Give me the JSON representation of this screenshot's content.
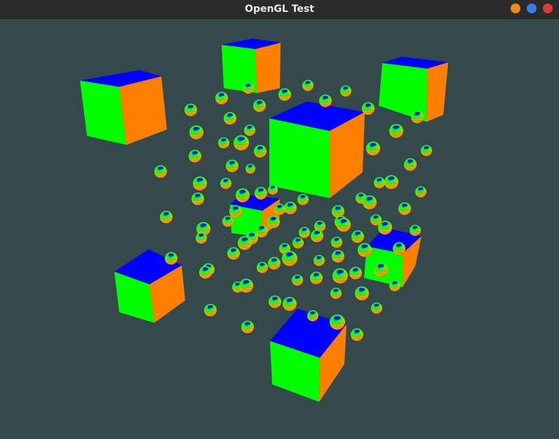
{
  "window": {
    "title": "OpenGL Test",
    "controls": [
      {
        "name": "minimize",
        "color": "#f08a1c"
      },
      {
        "name": "maximize",
        "color": "#3b7cea"
      },
      {
        "name": "close",
        "color": "#e03b3b"
      }
    ]
  },
  "scene": {
    "background": "#33494b",
    "status_text": "",
    "colors": {
      "cube_top": "#0000ff",
      "cube_front": "#00ff00",
      "cube_side": "#ff8000"
    }
  }
}
